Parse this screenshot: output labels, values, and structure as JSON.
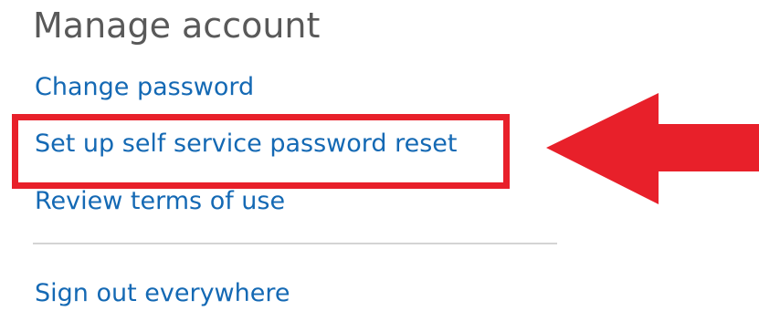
{
  "section": {
    "heading": "Manage account"
  },
  "links": {
    "change_password": "Change password",
    "self_service_reset": "Set up self service password reset",
    "review_terms": "Review terms of use",
    "sign_out_everywhere": "Sign out everywhere"
  },
  "annotations": {
    "highlight_color": "#e8202a",
    "arrow_color": "#e8202a",
    "arrow_direction": "left",
    "highlighted_item": "self_service_reset"
  },
  "colors": {
    "link": "#1469b4",
    "heading": "#595959",
    "divider": "#d4d4d4"
  }
}
